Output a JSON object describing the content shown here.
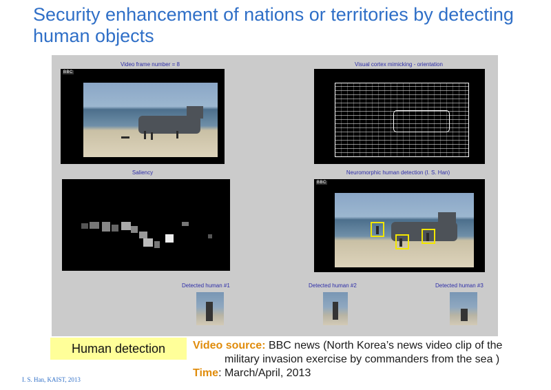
{
  "slide": {
    "title": "Security enhancement of nations or territories by detecting human objects",
    "credit": "I. S. Han, KAIST, 2013"
  },
  "panel": {
    "frame_label": "Video frame number = 8",
    "visual_cortex_label": "Visual cortex mimicking - orientation",
    "saliency_label": "Saliency",
    "detection_label": "Neuromorphic human detection (I. S. Han)",
    "bbc_badge": "BBC",
    "detected": [
      {
        "label": "Detected human #1"
      },
      {
        "label": "Detected human #2"
      },
      {
        "label": "Detected human #3"
      }
    ]
  },
  "footer": {
    "human_detection": "Human detection",
    "video_source_key": "Video source:",
    "video_source_line1": " BBC news (North Korea’s news video clip of the",
    "video_source_line2": "military invasion exercise by commanders from the sea )",
    "time_key": "Time",
    "time_value": ": March/April, 2013"
  },
  "colors": {
    "title_blue": "#2f6fc7",
    "label_blue": "#2d2da8",
    "panel_gray": "#cbcbcb",
    "highlight_yellow": "#ffff99",
    "key_orange": "#e08c0c",
    "detection_box_yellow": "#f2e600"
  }
}
